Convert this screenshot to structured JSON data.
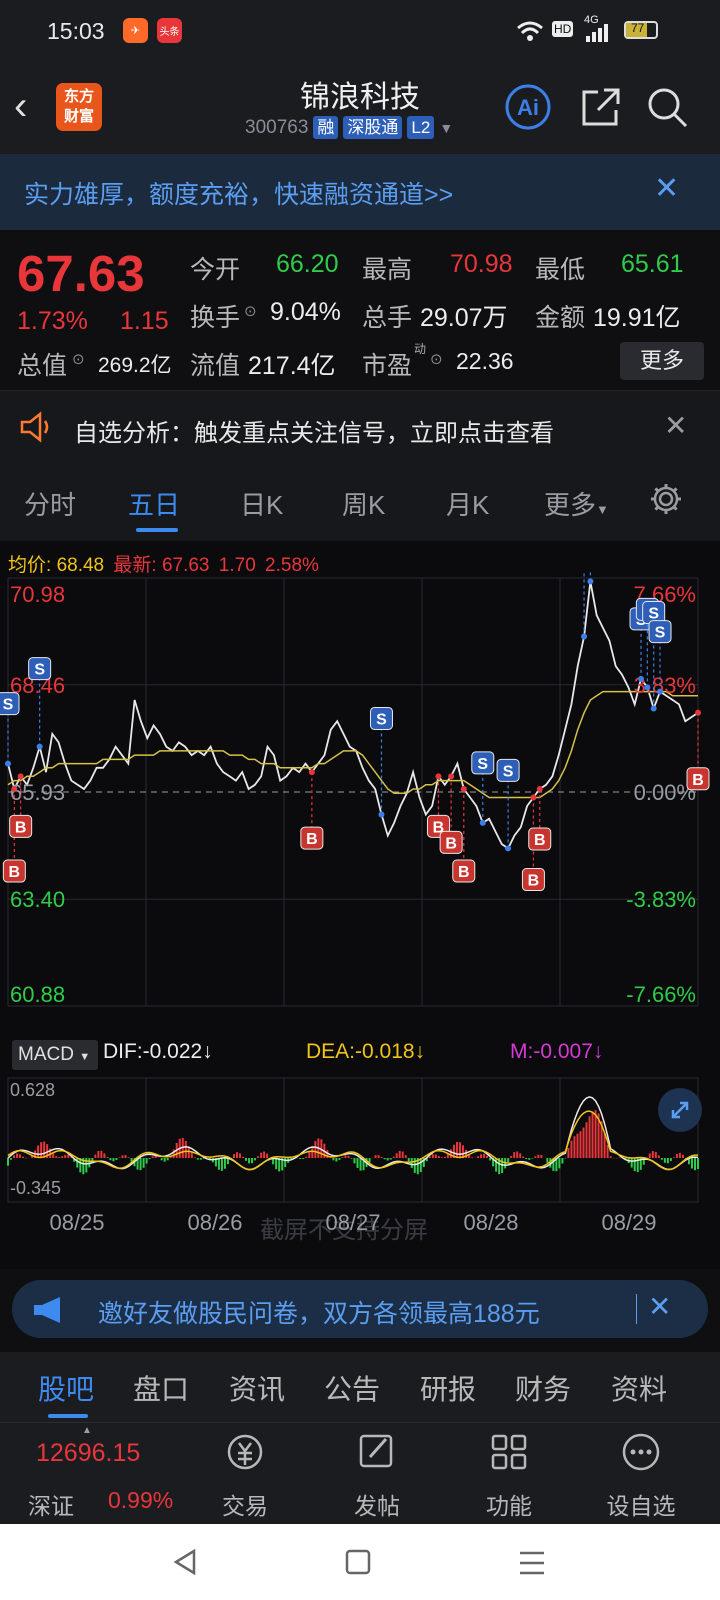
{
  "status_bar": {
    "time": "15:03",
    "app_badge_2": "头条",
    "battery": "77",
    "hd": "HD",
    "net": "4G"
  },
  "header": {
    "back_symbol": "‹",
    "logo_line1": "东方",
    "logo_line2": "财富",
    "title": "锦浪科技",
    "code": "300763",
    "tags": [
      "融",
      "深股通",
      "L2"
    ]
  },
  "promo_banner": {
    "text": "实力雄厚，额度充裕，快速融资通道>>"
  },
  "quote": {
    "price": "67.63",
    "change_pct": "1.73%",
    "change": "1.15",
    "open_label": "今开",
    "open": "66.20",
    "high_label": "最高",
    "high": "70.98",
    "low_label": "最低",
    "low": "65.61",
    "turnover_label": "换手",
    "turnover": "9.04%",
    "volume_label": "总手",
    "volume": "29.07万",
    "amount_label": "金额",
    "amount": "19.91亿",
    "mktcap_label": "总值",
    "mktcap": "269.2亿",
    "float_label": "流值",
    "float": "217.4亿",
    "pe_label": "市盈",
    "pe_sup": "动",
    "pe": "22.36",
    "more_label": "更多"
  },
  "notice": {
    "text": "自选分析：触发重点关注信号，立即点击查看"
  },
  "tabs": [
    "分时",
    "五日",
    "日K",
    "周K",
    "月K",
    "更多"
  ],
  "active_tab": "五日",
  "chart_header": {
    "avg_label": "均价:",
    "avg": "68.48",
    "latest_label": "最新:",
    "latest": "67.63",
    "chg": "1.70",
    "chg_pct": "2.58%"
  },
  "chart_data": [
    {
      "type": "line",
      "x": [
        "08/25",
        "08/26",
        "08/27",
        "08/28",
        "08/29"
      ],
      "y_ticks": [
        "70.98",
        "68.46",
        "65.93",
        "63.40",
        "60.88"
      ],
      "y_right_ticks": [
        "7.66%",
        "3.83%",
        "0.00%",
        "-3.83%",
        "-7.66%"
      ],
      "ylim": [
        60.88,
        70.98
      ],
      "series": [
        {
          "values": [
            66.6,
            66.0,
            66.3,
            66.1,
            66.5,
            67.0,
            66.4,
            67.3,
            67.1,
            66.6,
            66.2,
            66.1,
            66.0,
            66.2,
            66.5,
            66.5,
            66.7,
            67.0,
            66.8,
            66.6,
            68.1,
            67.6,
            67.2,
            67.5,
            67.3,
            67.0,
            66.9,
            67.1,
            67.0,
            66.8,
            66.9,
            66.8,
            67.0,
            66.6,
            66.4,
            66.3,
            66.2,
            66.4,
            66.0,
            66.1,
            66.3,
            67.0,
            66.8,
            66.2,
            66.3,
            66.5,
            66.4,
            66.6,
            66.4,
            66.6,
            66.8,
            67.4,
            67.6,
            67.3,
            67.0,
            66.9,
            66.5,
            66.2,
            66.0,
            65.4,
            64.9,
            65.2,
            65.6,
            65.9,
            66.4,
            65.8,
            65.4,
            65.6,
            66.3,
            66.1,
            66.3,
            66.6,
            66.0,
            65.8,
            65.6,
            65.2,
            65.3,
            65.0,
            64.7,
            64.6,
            64.9,
            65.1,
            65.6,
            65.8,
            66.0,
            66.1,
            66.3,
            66.8,
            67.4,
            68.0,
            68.9,
            69.6,
            70.9,
            70.1,
            69.8,
            69.5,
            68.9,
            68.7,
            68.4,
            68.0,
            68.6,
            68.4,
            67.9,
            68.3,
            68.2,
            68.1,
            68.0,
            67.6,
            67.7,
            67.8
          ],
          "color": "#e8e8e8"
        },
        {
          "values": [
            66.1,
            66.2,
            66.2,
            66.3,
            66.3,
            66.4,
            66.5,
            66.5,
            66.6,
            66.6,
            66.6,
            66.6,
            66.6,
            66.6,
            66.6,
            66.7,
            66.7,
            66.7,
            66.7,
            66.7,
            66.8,
            66.8,
            66.8,
            66.8,
            66.9,
            66.9,
            66.9,
            66.9,
            66.9,
            66.9,
            66.9,
            66.9,
            66.9,
            66.9,
            66.9,
            66.8,
            66.8,
            66.8,
            66.7,
            66.7,
            66.6,
            66.6,
            66.6,
            66.5,
            66.5,
            66.5,
            66.5,
            66.5,
            66.5,
            66.6,
            66.6,
            66.7,
            66.8,
            66.9,
            66.9,
            66.9,
            66.8,
            66.6,
            66.4,
            66.2,
            66.0,
            65.9,
            65.9,
            65.9,
            66.0,
            66.0,
            66.1,
            66.1,
            66.2,
            66.2,
            66.2,
            66.2,
            66.2,
            66.1,
            66.0,
            65.9,
            65.8,
            65.8,
            65.8,
            65.8,
            65.8,
            65.8,
            65.8,
            65.8,
            65.8,
            65.9,
            66.0,
            66.2,
            66.5,
            66.9,
            67.4,
            67.8,
            68.1,
            68.2,
            68.3,
            68.3,
            68.3,
            68.3,
            68.3,
            68.3,
            68.3,
            68.3,
            68.3,
            68.3,
            68.3,
            68.2,
            68.2,
            68.2,
            68.2,
            68.2
          ],
          "color": "#d4c24a"
        }
      ],
      "markers": [
        {
          "type": "S",
          "index": 0
        },
        {
          "type": "S",
          "index": 5
        },
        {
          "type": "B",
          "index": 1
        },
        {
          "type": "B",
          "index": 2
        },
        {
          "type": "B",
          "index": 48
        },
        {
          "type": "S",
          "index": 59
        },
        {
          "type": "B",
          "index": 68
        },
        {
          "type": "B",
          "index": 70
        },
        {
          "type": "B",
          "index": 72
        },
        {
          "type": "S",
          "index": 75
        },
        {
          "type": "S",
          "index": 79
        },
        {
          "type": "B",
          "index": 83
        },
        {
          "type": "B",
          "index": 84
        },
        {
          "type": "S",
          "index": 91
        },
        {
          "type": "S",
          "index": 92
        },
        {
          "type": "S",
          "index": 100
        },
        {
          "type": "S",
          "index": 101
        },
        {
          "type": "S",
          "index": 102
        },
        {
          "type": "S",
          "index": 103
        },
        {
          "type": "B",
          "index": 113
        }
      ]
    },
    {
      "type": "bar",
      "indicator": "MACD",
      "dif_label": "DIF:-0.022",
      "dea_label": "DEA:-0.018",
      "m_label": "M:-0.007",
      "y_ticks": [
        "0.628",
        "-0.345"
      ],
      "ylim": [
        -0.345,
        0.628
      ],
      "x": [
        "08/25",
        "08/26",
        "08/27",
        "08/28",
        "08/29"
      ]
    }
  ],
  "watermark": "截屏不支持分屏",
  "invite_banner": {
    "text": "邀好友做股民问卷，双方各领最高188元"
  },
  "subnav": [
    "股吧",
    "盘口",
    "资讯",
    "公告",
    "研报",
    "财务",
    "资料"
  ],
  "toolbar": {
    "index_value": "12696.15",
    "index_name": "深证",
    "index_change": "0.99%",
    "items": [
      "交易",
      "发帖",
      "功能",
      "设自选"
    ]
  }
}
